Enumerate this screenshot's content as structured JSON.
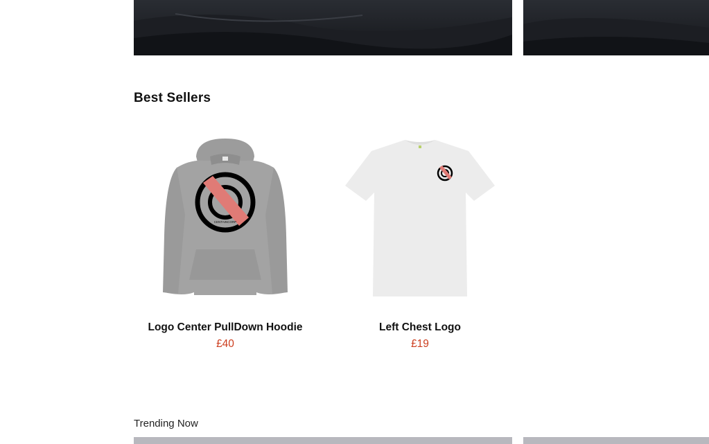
{
  "best_sellers": {
    "title": "Best Sellers",
    "products": [
      {
        "name": "Logo Center PullDown Hoodie",
        "price": "£40",
        "logo_text": "CENTAINCORP"
      },
      {
        "name": "Left Chest Logo",
        "price": "£19"
      }
    ]
  },
  "trending": {
    "title": "Trending Now"
  },
  "colors": {
    "price": "#cc3d1e",
    "logo_accent": "#e07b76",
    "hoodie": "#a3a3a3",
    "tshirt": "#ececec"
  }
}
